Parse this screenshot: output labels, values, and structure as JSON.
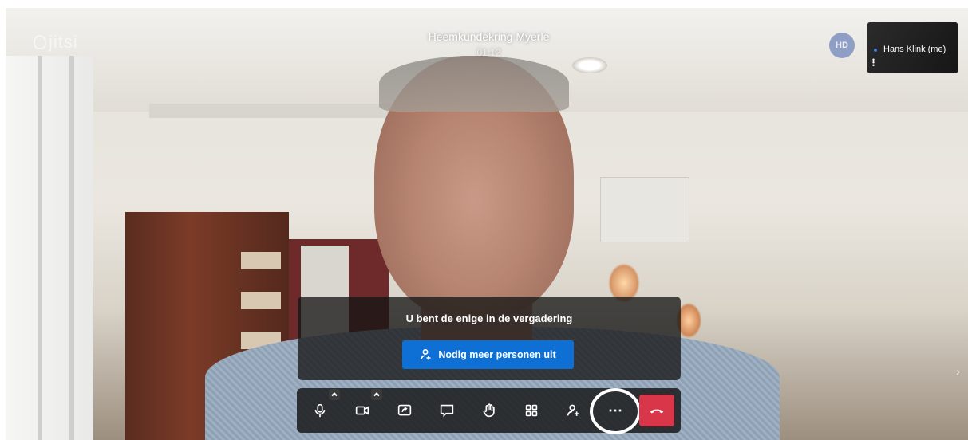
{
  "app": {
    "logo_text": "jitsi",
    "meeting_title": "Heemkundekring Myerle",
    "timer": "01:12"
  },
  "participants": {
    "avatar_initials": "HD",
    "self_label": "Hans Klink (me)"
  },
  "notice": {
    "message": "U bent de enige in de vergadering",
    "invite_button": "Nodig meer personen uit"
  },
  "toolbar": {
    "buttons": [
      {
        "icon": "microphone-icon"
      },
      {
        "icon": "camera-icon"
      },
      {
        "icon": "screen-share-icon"
      },
      {
        "icon": "chat-icon"
      },
      {
        "icon": "raise-hand-icon"
      },
      {
        "icon": "tile-view-icon"
      },
      {
        "icon": "invite-people-icon"
      },
      {
        "icon": "more-actions-icon"
      },
      {
        "icon": "hangup-icon"
      }
    ],
    "more_symbol": "⋯"
  },
  "colors": {
    "invite_button": "#0e6fd4",
    "hangup": "#d9364a",
    "toolbar_bg": "#141414"
  }
}
